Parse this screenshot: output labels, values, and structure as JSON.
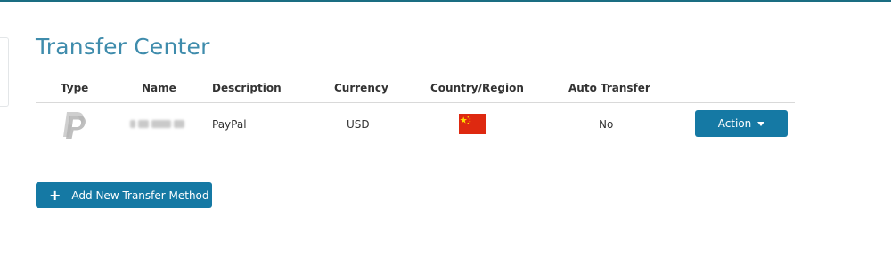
{
  "page": {
    "title": "Transfer Center"
  },
  "table": {
    "headers": {
      "type": "Type",
      "name": "Name",
      "description": "Description",
      "currency": "Currency",
      "country": "Country/Region",
      "auto_transfer": "Auto Transfer"
    },
    "rows": [
      {
        "type_icon": "paypal-logo-icon",
        "name": "",
        "description": "PayPal",
        "currency": "USD",
        "country_flag": "china-flag-icon",
        "auto_transfer": "No",
        "action_label": "Action"
      }
    ]
  },
  "add_button": {
    "label": "Add New Transfer Method"
  },
  "colors": {
    "accent": "#1579a4",
    "title": "#3f8cac",
    "top_rule": "#1a6d82",
    "flag_red": "#de2910",
    "flag_star": "#ffde00"
  }
}
